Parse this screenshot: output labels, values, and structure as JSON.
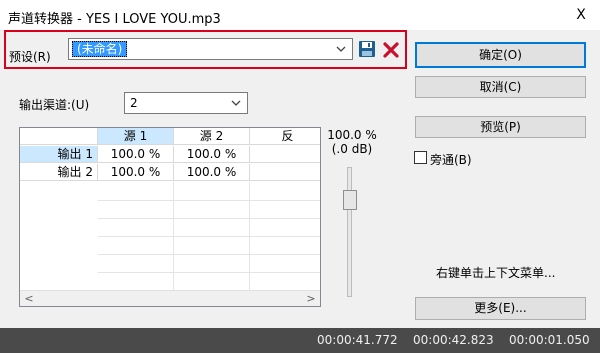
{
  "window": {
    "title": "声道转换器 - YES I LOVE YOU.mp3",
    "close_glyph": "X"
  },
  "preset": {
    "label": "预设(R)",
    "value": "(未命名)"
  },
  "buttons": {
    "ok": "确定(O)",
    "cancel": "取消(C)",
    "preview": "预览(P)",
    "more": "更多(E)..."
  },
  "bypass": {
    "label": "旁通(B)",
    "checked": false
  },
  "context_hint": "右键单击上下文菜单...",
  "output_channels": {
    "label": "输出渠道:(U)",
    "value": "2"
  },
  "grid": {
    "columns": [
      "源 1",
      "源 2",
      "反"
    ],
    "rows": [
      {
        "label": "输出 1",
        "values": [
          "100.0 %",
          "100.0 %",
          ""
        ]
      },
      {
        "label": "输出 2",
        "values": [
          "100.0 %",
          "100.0 %",
          ""
        ]
      }
    ]
  },
  "level": {
    "percent": "100.0 %",
    "db": "(.0 dB)"
  },
  "status": {
    "start": "00:00:41.772",
    "end": "00:00:42.823",
    "length": "00:00:01.050"
  },
  "colors": {
    "highlight_box": "#d9001b",
    "selection": "#3399ff",
    "selected_header": "#cce8ff",
    "status_bar": "#4a4a4a"
  }
}
